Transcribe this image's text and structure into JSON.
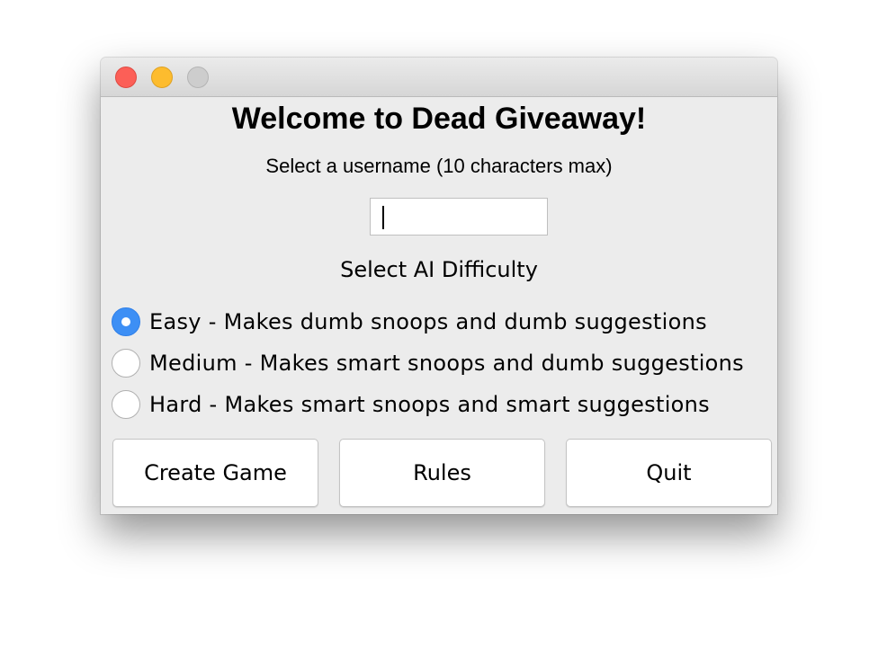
{
  "window": {
    "controls": [
      {
        "name": "close",
        "color": "#fc5f57"
      },
      {
        "name": "minimize",
        "color": "#fdbc2e"
      },
      {
        "name": "zoom",
        "color": "#cdcdcd"
      }
    ]
  },
  "header": {
    "title": "Welcome to Dead Giveaway!",
    "username_prompt": "Select a username (10 characters max)"
  },
  "username": {
    "value": "",
    "placeholder": ""
  },
  "difficulty": {
    "label": "Select AI Difficulty",
    "selected": "easy",
    "options": [
      {
        "id": "easy",
        "label": "Easy - Makes dumb snoops and dumb suggestions",
        "selected": true
      },
      {
        "id": "medium",
        "label": "Medium - Makes smart snoops and dumb suggestions",
        "selected": false
      },
      {
        "id": "hard",
        "label": "Hard - Makes smart snoops and smart suggestions",
        "selected": false
      }
    ]
  },
  "buttons": {
    "create_game": "Create Game",
    "rules": "Rules",
    "quit": "Quit"
  },
  "colors": {
    "accent": "#3d8ff5",
    "window_bg": "#ececec"
  }
}
